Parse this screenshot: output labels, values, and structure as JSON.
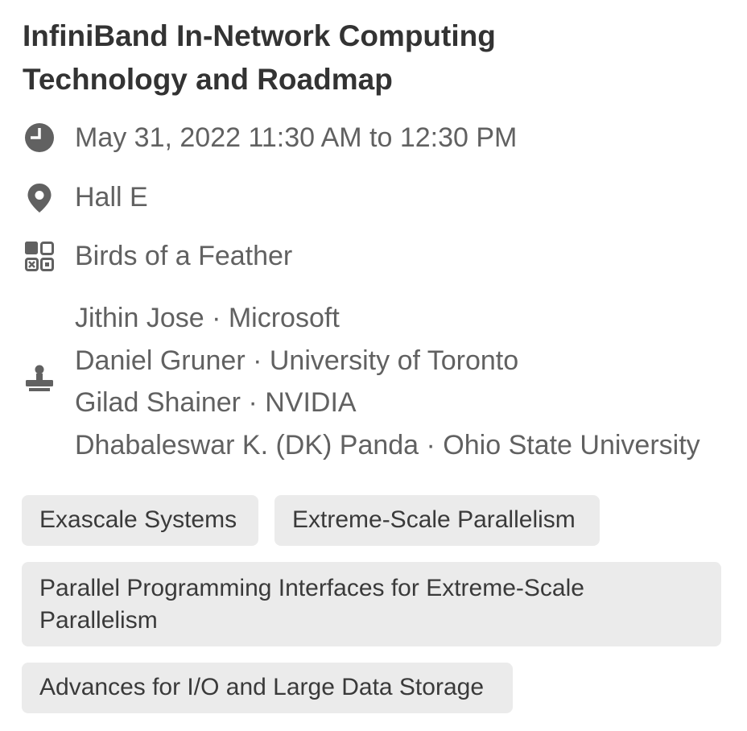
{
  "session": {
    "title_line1": "InfiniBand In-Network Computing",
    "title_line2": "Technology and Roadmap",
    "time": "May 31, 2022 11:30 AM to 12:30 PM",
    "room": "Hall E",
    "session_type": "Birds of a Feather",
    "presenters": [
      "Jithin Jose · Microsoft",
      "Daniel Gruner · University of Toronto",
      "Gilad Shainer · NVIDIA",
      "Dhabaleswar K. (DK) Panda · Ohio State University"
    ],
    "tags": [
      "Exascale Systems",
      "Extreme-Scale Parallelism",
      "Parallel Programming Interfaces for Extreme-Scale Parallelism",
      "Advances for I/O and Large Data Storage"
    ]
  },
  "icons": {
    "time": "clock-icon",
    "room": "location-pin-icon",
    "session_type": "category-grid-icon",
    "presenters": "presenter-podium-icon"
  },
  "colors": {
    "title": "#333333",
    "body_text": "#616161",
    "icon": "#616161",
    "tag_background": "#ebebeb",
    "tag_text": "#3a3a3a"
  }
}
